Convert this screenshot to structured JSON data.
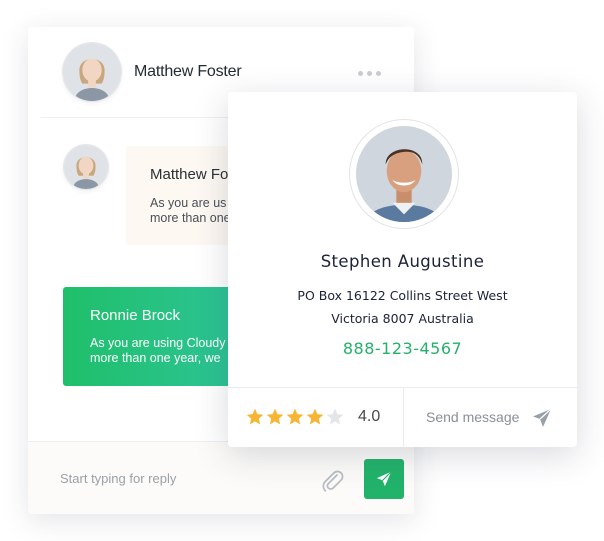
{
  "chat": {
    "header": {
      "name": "Matthew Foster"
    },
    "messages": [
      {
        "name": "Matthew Fo",
        "text": "As you are us\nmore than one"
      },
      {
        "name": "Ronnie Brock",
        "text": "As you are using Cloudy\nmore than one year, we"
      }
    ],
    "composer": {
      "placeholder": "Start typing for reply"
    }
  },
  "profile": {
    "name": "Stephen Augustine",
    "address_line1": "PO Box 16122 Collins Street West",
    "address_line2": "Victoria 8007 Australia",
    "phone": "888-123-4567",
    "rating": {
      "value": 4.0,
      "label": "4.0",
      "max": 5
    },
    "send_message_label": "Send message"
  },
  "colors": {
    "accent": "#22b36b",
    "bubble_gradient_start": "#1fbf6a",
    "bubble_gradient_end": "#33c6a8",
    "star": "#f6b634",
    "star_empty": "#e3e5e8"
  },
  "icons": {
    "more": "more-horizontal-icon",
    "attach": "paperclip-icon",
    "send": "send-icon",
    "star": "star-icon",
    "send_message": "paper-plane-icon"
  }
}
